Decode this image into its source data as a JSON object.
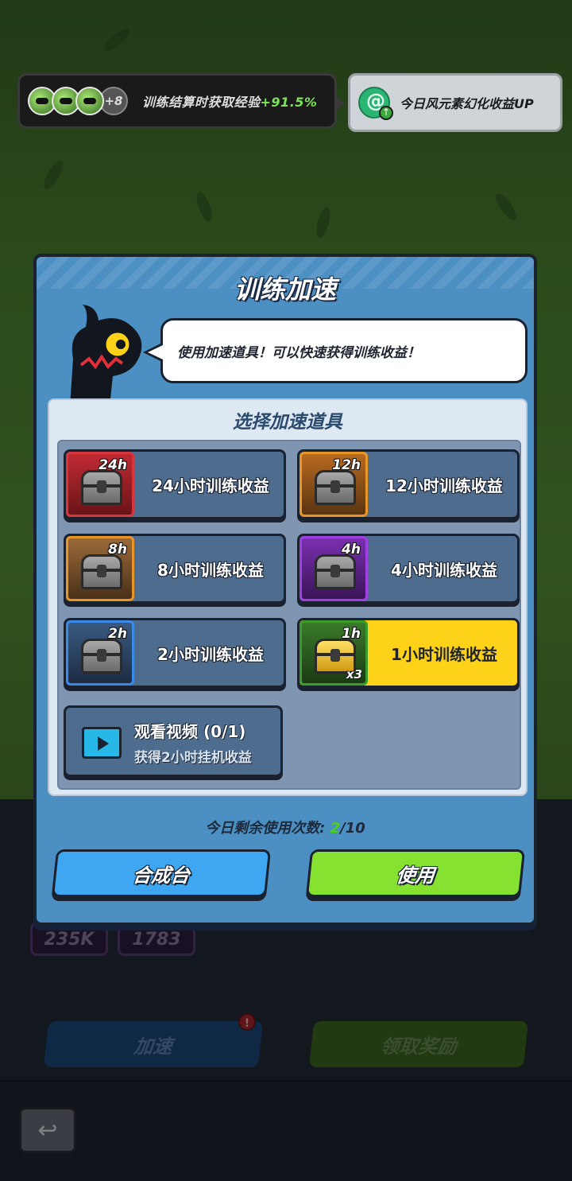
{
  "buff": {
    "more_count": "+8",
    "text_prefix": "训练结算时获取经验",
    "text_value": "+91.5%"
  },
  "element_bonus": {
    "text": "今日风元素幻化收益UP"
  },
  "background": {
    "stat_1": "235K",
    "stat_2": "1783",
    "speed_button": "加速",
    "claim_button": "领取奖励",
    "badge": "!"
  },
  "dialog": {
    "title": "训练加速",
    "speech": "使用加速道具！可以快速获得训练收益！",
    "panel_title": "选择加速道具",
    "items": [
      {
        "tag": "24h",
        "label": "24小时训练收益",
        "count": ""
      },
      {
        "tag": "12h",
        "label": "12小时训练收益",
        "count": ""
      },
      {
        "tag": "8h",
        "label": "8小时训练收益",
        "count": ""
      },
      {
        "tag": "4h",
        "label": "4小时训练收益",
        "count": ""
      },
      {
        "tag": "2h",
        "label": "2小时训练收益",
        "count": ""
      },
      {
        "tag": "1h",
        "label": "1小时训练收益",
        "count": "x3"
      }
    ],
    "video": {
      "title": "观看视频 (0/1)",
      "subtitle": "获得2小时挂机收益"
    },
    "remaining_label": "今日剩余使用次数:",
    "remaining_used": "2",
    "remaining_total": "/10",
    "craft_button": "合成台",
    "use_button": "使用"
  },
  "colors": {
    "dialog_bg": "#4c8fc3",
    "selected_item": "#ffd21a",
    "use_button": "#86e230",
    "craft_button": "#3fa6f2",
    "rarity_red": "#d8343c",
    "rarity_orange": "#e8962a",
    "rarity_purple": "#a040e0",
    "rarity_blue": "#3a8ae8",
    "rarity_green": "#3a9a2a"
  }
}
